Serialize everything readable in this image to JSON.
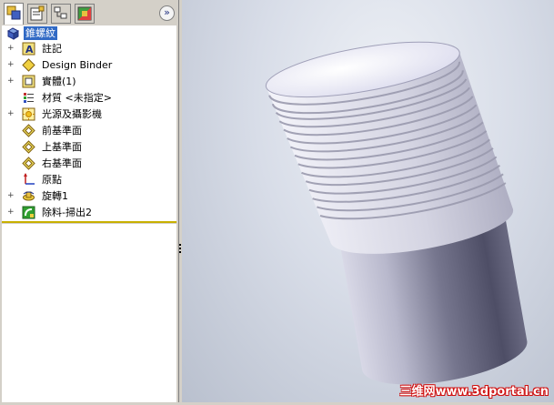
{
  "panel": {
    "tabs": [
      {
        "icon": "feature-manager-icon"
      },
      {
        "icon": "property-manager-icon"
      },
      {
        "icon": "configuration-manager-icon"
      },
      {
        "icon": "display-manager-icon"
      }
    ],
    "expand_symbol": "»"
  },
  "tree": {
    "root": {
      "label": "錐螺紋",
      "icon": "part-icon"
    },
    "items": [
      {
        "label": "註記",
        "icon": "annotations-icon",
        "expandable": true
      },
      {
        "label": "Design Binder",
        "icon": "design-binder-icon",
        "expandable": true
      },
      {
        "label": "實體(1)",
        "icon": "solid-bodies-icon",
        "expandable": true
      },
      {
        "label": "材質 <未指定>",
        "icon": "material-icon",
        "expandable": false
      },
      {
        "label": "光源及攝影機",
        "icon": "lights-cameras-icon",
        "expandable": true
      },
      {
        "label": "前基準面",
        "icon": "plane-icon",
        "expandable": false
      },
      {
        "label": "上基準面",
        "icon": "plane-icon",
        "expandable": false
      },
      {
        "label": "右基準面",
        "icon": "plane-icon",
        "expandable": false
      },
      {
        "label": "原點",
        "icon": "origin-icon",
        "expandable": false
      },
      {
        "label": "旋轉1",
        "icon": "revolve-icon",
        "expandable": true
      },
      {
        "label": "除料-掃出2",
        "icon": "swept-cut-icon",
        "expandable": true
      }
    ]
  },
  "viewport": {
    "watermark": "三维网www.3dportal.cn"
  },
  "colors": {
    "selection": "#316ac5",
    "divider": "#c8b000",
    "watermark_outline": "#d01010"
  }
}
